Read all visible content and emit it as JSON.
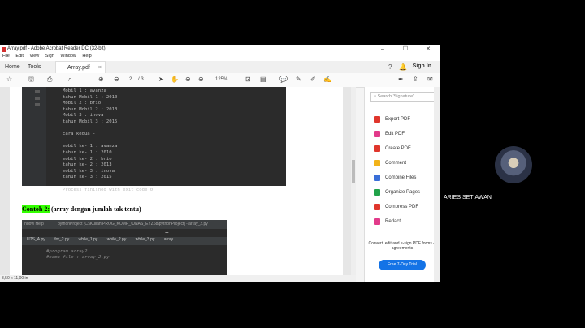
{
  "window": {
    "title": "Array.pdf - Adobe Acrobat Reader DC (32-bit)",
    "controls": [
      "–",
      "☐",
      "✕"
    ]
  },
  "menu": [
    "File",
    "Edit",
    "View",
    "Sign",
    "Window",
    "Help"
  ],
  "tabs": {
    "home": "Home",
    "tools": "Tools",
    "doc": "Array.pdf",
    "doc_close": "×"
  },
  "signin": "Sign In",
  "toolbar": {
    "page_current": "2",
    "page_total": "/ 3",
    "zoom": "125%"
  },
  "document": {
    "output_lines": [
      "Mobil 1 : avanza",
      "tahun Mobil 1 : 2010",
      "Mobil 2 : brio",
      "tahun Mobil 2 : 2013",
      "Mobil 3 : inova",
      "tahun Mobil 3 : 2015",
      "",
      "cara kedua -",
      "",
      "mobil ke- 1 : avanza",
      "tahun ke- 1 : 2010",
      "mobil ke- 2 : brio",
      "tahun ke- 2 : 2013",
      "mobil ke- 3 : inova",
      "tahun ke- 3 : 2015",
      "",
      "Process finished with exit code 0"
    ],
    "example_label": "Contoh 2:",
    "example_text": " (array dengan jumlah tak tentu)",
    "ide_menu": "indow  Help",
    "ide_path": "pythonProject [C:\\Kuliah\\PROG_KOMP_\\UNAS_EYZ68\\pythonProject] - array_2.py",
    "ide_tabs": [
      "UTS_A.py",
      "for_2.py",
      "while_1.py",
      "while_2.py",
      "while_3.py",
      "array"
    ],
    "code_lines": [
      "#program array2",
      "#nama file : array_2.py"
    ]
  },
  "statusbar": "8,50 x 11,00 in",
  "right_pane": {
    "search_placeholder": "Search 'Signature'",
    "items": [
      {
        "label": "Export PDF",
        "color": "#e0362c"
      },
      {
        "label": "Edit PDF",
        "color": "#e23a8a"
      },
      {
        "label": "Create PDF",
        "color": "#e0362c"
      },
      {
        "label": "Comment",
        "color": "#f2b31a"
      },
      {
        "label": "Combine Files",
        "color": "#3a6fd8"
      },
      {
        "label": "Organize Pages",
        "color": "#22a34a"
      },
      {
        "label": "Compress PDF",
        "color": "#e0362c"
      },
      {
        "label": "Redact",
        "color": "#e23a8a"
      }
    ],
    "promo": "Convert, edit and e-sign PDF forms & agreements",
    "trial_button": "Free 7-Day Trial"
  },
  "participant": {
    "name": "ARIES SETIAWAN"
  }
}
